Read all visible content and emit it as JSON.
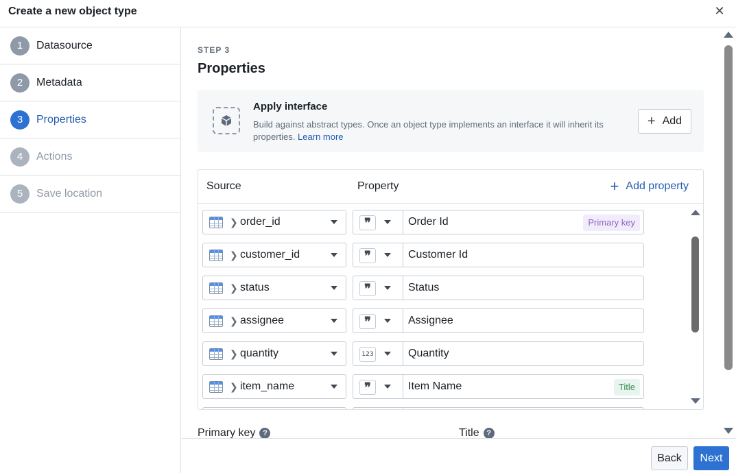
{
  "dialog": {
    "title": "Create a new object type",
    "close_icon": "close-icon"
  },
  "sidebar": {
    "steps": [
      {
        "num": "1",
        "label": "Datasource",
        "state": "done"
      },
      {
        "num": "2",
        "label": "Metadata",
        "state": "done"
      },
      {
        "num": "3",
        "label": "Properties",
        "state": "active"
      },
      {
        "num": "4",
        "label": "Actions",
        "state": "disabled"
      },
      {
        "num": "5",
        "label": "Save location",
        "state": "disabled"
      }
    ]
  },
  "main": {
    "step_label": "STEP 3",
    "title": "Properties",
    "interface": {
      "title": "Apply interface",
      "description": "Build against abstract types. Once an object type implements an interface it will inherit its properties.",
      "learn_more": "Learn more",
      "add_label": "Add",
      "icon": "cube-icon"
    },
    "table": {
      "col_source": "Source",
      "col_property": "Property",
      "add_property": "Add property",
      "rows": [
        {
          "source": "order_id",
          "type": "string",
          "type_glyph": "❞",
          "name": "Order Id",
          "tag": "Primary key",
          "tag_kind": "primary"
        },
        {
          "source": "customer_id",
          "type": "string",
          "type_glyph": "❞",
          "name": "Customer Id",
          "tag": "",
          "tag_kind": ""
        },
        {
          "source": "status",
          "type": "string",
          "type_glyph": "❞",
          "name": "Status",
          "tag": "",
          "tag_kind": ""
        },
        {
          "source": "assignee",
          "type": "string",
          "type_glyph": "❞",
          "name": "Assignee",
          "tag": "",
          "tag_kind": ""
        },
        {
          "source": "quantity",
          "type": "integer",
          "type_glyph": "123",
          "name": "Quantity",
          "tag": "",
          "tag_kind": ""
        },
        {
          "source": "item_name",
          "type": "string",
          "type_glyph": "❞",
          "name": "Item Name",
          "tag": "Title",
          "tag_kind": "title"
        },
        {
          "source": "",
          "type": "string",
          "type_glyph": "",
          "name": "",
          "tag": "",
          "tag_kind": ""
        }
      ]
    },
    "primary_key_label": "Primary key",
    "title_label": "Title"
  },
  "footer": {
    "back_label": "Back",
    "next_label": "Next"
  },
  "colors": {
    "accent": "#2d72d2",
    "link": "#215db0",
    "primary_tag": "#9063c8",
    "title_tag": "#3b8a5a"
  }
}
